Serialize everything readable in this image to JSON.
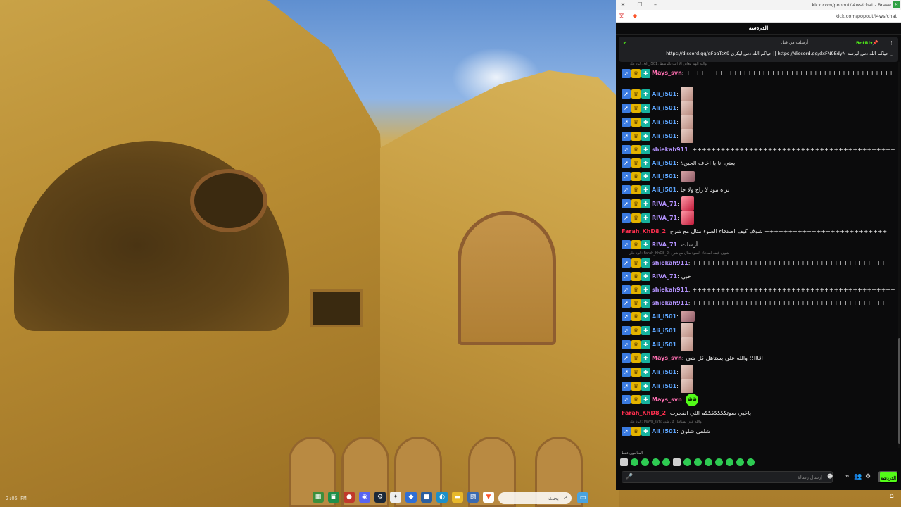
{
  "browser": {
    "title": "kick.com/popout/i4ws/chat - Brave",
    "url": "kick.com/popout/i4ws/chat",
    "minimize": "–",
    "maximize": "☐",
    "close": "✕"
  },
  "chat": {
    "header_title": "الدردشة",
    "pinned": {
      "user": "BotRix",
      "meta": "أرسلت من قبل",
      "text_a": "حياكم الله دس ليكرن ||",
      "link_a": "https://discord.gg/gFpaTsK9",
      "text_b": "حياكم الله دس ليرسه",
      "link_b": "https://discord.gg/dxFN9EdyN"
    },
    "reply_top": "الرد على: Ali_i501: والله الهم معاني الا ابت بالرسط",
    "reply_mid": "الرد على: Farah_KhD8_2: شوف كيف اصدقاء السوء مثال مع شرح",
    "reply_bottom": "الرد على: Mays_svn: والله علي بستاهل كل شي",
    "messages": [
      {
        "user": "Mays_svn",
        "color": "u-pink",
        "text": "",
        "type": "tall",
        "extra": "+++++++++++++++++++++++++++++++++++++++++++++++++++++++++++++++++++++"
      },
      {
        "user": "Ali_i501",
        "color": "u-blue",
        "text": "",
        "type": "emote"
      },
      {
        "user": "Ali_i501",
        "color": "u-blue",
        "text": "",
        "type": "emote"
      },
      {
        "user": "Ali_i501",
        "color": "u-blue",
        "text": "",
        "type": "emote"
      },
      {
        "user": "Ali_i501",
        "color": "u-blue",
        "text": "",
        "type": "emote"
      },
      {
        "user": "shiekah911",
        "color": "u-purple",
        "text": "+++++++++++++++++++++++++++++++++++++++++++++++++++++++++++",
        "type": "text"
      },
      {
        "user": "Ali_i501",
        "color": "u-blue",
        "text": "يعني انا يا اخاف الجين؟",
        "type": "text"
      },
      {
        "user": "Ali_i501",
        "color": "u-blue",
        "text": "",
        "type": "emote-sm"
      },
      {
        "user": "Ali_i501",
        "color": "u-blue",
        "text": "تراه مود لا راح ولا جا",
        "type": "text"
      },
      {
        "user": "RIVA_71",
        "color": "u-purple",
        "text": "",
        "type": "emote-red"
      },
      {
        "user": "RIVA_71",
        "color": "u-purple",
        "text": "",
        "type": "emote-red"
      },
      {
        "user": "Farah_KhD8_2",
        "color": "u-red",
        "text": "شوف كيف اصدقاء السوء مثال مع شرح ++++++++++++++++++++++++++",
        "type": "text",
        "nobadge": true
      },
      {
        "user": "RIVA_71",
        "color": "u-purple",
        "text": "أرسلت",
        "type": "text"
      },
      {
        "user": "shiekah911",
        "color": "u-purple",
        "text": "++++++++++++++++++++++++++++++++++++++++++++++++++++++++++",
        "type": "text",
        "reply": "mid"
      },
      {
        "user": "RIVA_71",
        "color": "u-purple",
        "text": "خبي",
        "type": "text"
      },
      {
        "user": "shiekah911",
        "color": "u-purple",
        "text": "+++++++++++++++++++++++++++++++++++++++++++++++++++++++++++",
        "type": "text"
      },
      {
        "user": "shiekah911",
        "color": "u-purple",
        "text": "+++++++++++++++++++++++++++++++++++++++++++++++++++++++++++",
        "type": "text"
      },
      {
        "user": "Ali_i501",
        "color": "u-blue",
        "text": "",
        "type": "emote-sm"
      },
      {
        "user": "Ali_i501",
        "color": "u-blue",
        "text": "",
        "type": "emote"
      },
      {
        "user": "Ali_i501",
        "color": "u-blue",
        "text": "",
        "type": "emote"
      },
      {
        "user": "Mays_svn",
        "color": "u-pink",
        "text": "اقااا!! والله علي بستاهل كل شي",
        "type": "text"
      },
      {
        "user": "Ali_i501",
        "color": "u-blue",
        "text": "",
        "type": "emote"
      },
      {
        "user": "Ali_i501",
        "color": "u-blue",
        "text": "",
        "type": "emote"
      },
      {
        "user": "Mays_svn",
        "color": "u-pink",
        "text": "",
        "type": "emote-green"
      },
      {
        "user": "Farah_KhD8_2",
        "color": "u-red",
        "text": "ياخيي صوتكككككككم اللي انفجرت",
        "type": "text",
        "nobadge": true
      },
      {
        "user": "Ali_i501",
        "color": "u-blue",
        "text": "شلفي شلون",
        "type": "text",
        "reply": "bottom"
      }
    ],
    "typing_label": "المتابعون فقط",
    "input_placeholder": "إرسال رسالة",
    "send_label": "الدردشة"
  },
  "taskbar": {
    "left_text": "2:05 PM",
    "search_placeholder": "بحث"
  },
  "colors": {
    "accent": "#53fc18",
    "chat_bg": "#0b0b0c"
  }
}
